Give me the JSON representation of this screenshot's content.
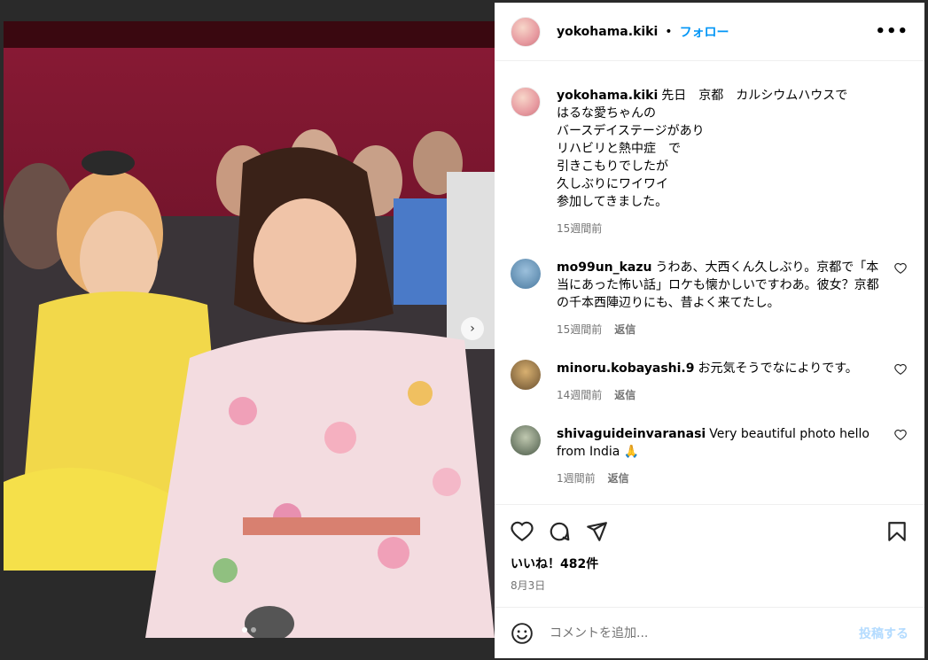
{
  "post": {
    "username": "yokohama.kiki",
    "separator": "•",
    "follow_label": "フォロー",
    "more_label": "•••",
    "image_count": 2,
    "current_image": 1
  },
  "caption": {
    "username": "yokohama.kiki",
    "text": "先日　京都　カルシウムハウスで\nはるな愛ちゃんの\nバースデイステージがあり\nリハビリと熱中症　で\n引きこもりでしたが\n久しぶりにワイワイ\n参加してきました。",
    "time": "15週間前"
  },
  "comments": [
    {
      "username": "mo99un_kazu",
      "text": "うわあ、大西くん久しぶり。京都で「本当にあった怖い話」ロケも懐かしいですわあ。彼女？京都の千本西陣辺りにも、昔よく来てたし。",
      "time": "15週間前",
      "reply_label": "返信",
      "avatar_color": "#4a7aa0"
    },
    {
      "username": "minoru.kobayashi.9",
      "text": "お元気そうでなによりです。",
      "time": "14週間前",
      "reply_label": "返信",
      "avatar_color": "#b08a4a"
    },
    {
      "username": "shivaguideinvaranasi",
      "text": "Very beautiful photo hello from India 🙏",
      "time": "1週間前",
      "reply_label": "返信",
      "avatar_color": "#7a8a70"
    }
  ],
  "likes": "いいね！482件",
  "date": "8月3日",
  "add_comment": {
    "placeholder": "コメントを追加...",
    "post_label": "投稿する"
  },
  "colors": {
    "accent": "#0095f6",
    "muted": "#737373",
    "post_disabled": "#b3dbff"
  }
}
